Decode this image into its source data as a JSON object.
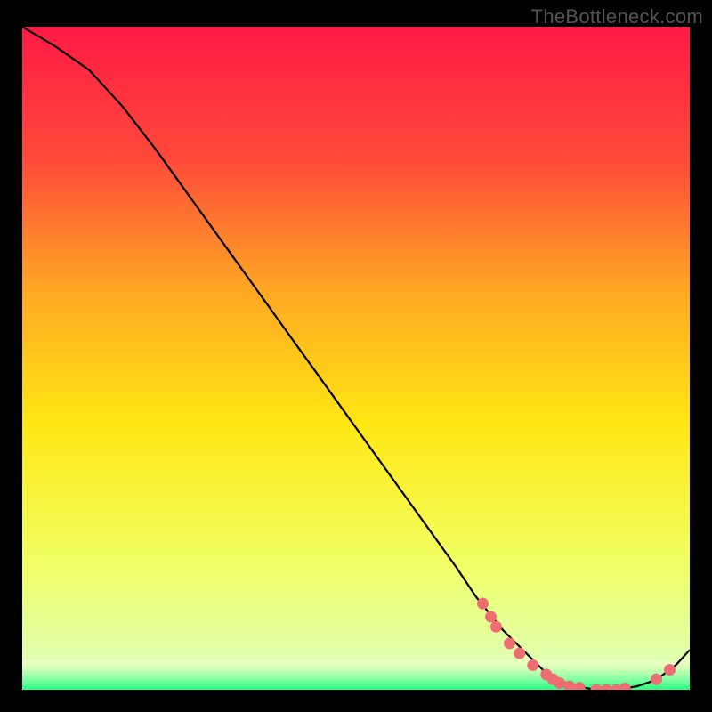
{
  "watermark": "TheBottleneck.com",
  "chart_data": {
    "type": "line",
    "title": "",
    "xlabel": "",
    "ylabel": "",
    "xlim": [
      0,
      100
    ],
    "ylim": [
      0,
      100
    ],
    "background_gradient": {
      "stops": [
        {
          "pos": 0.0,
          "color": "#ff1a45"
        },
        {
          "pos": 0.2,
          "color": "#ff4a3a"
        },
        {
          "pos": 0.4,
          "color": "#ffa822"
        },
        {
          "pos": 0.6,
          "color": "#ffe714"
        },
        {
          "pos": 0.8,
          "color": "#f2ff60"
        },
        {
          "pos": 0.965,
          "color": "#dfffb4"
        },
        {
          "pos": 0.985,
          "color": "#7dffa8"
        },
        {
          "pos": 1.0,
          "color": "#1efc7b"
        }
      ]
    },
    "series": [
      {
        "name": "curve",
        "color": "#000000",
        "x": [
          0,
          5,
          10,
          15,
          20,
          25,
          30,
          35,
          40,
          45,
          50,
          55,
          60,
          65,
          68,
          72,
          76,
          78,
          80,
          83,
          86,
          89,
          92,
          95,
          98,
          100
        ],
        "y": [
          100,
          97,
          93.5,
          88,
          81.5,
          74.5,
          67.5,
          60.5,
          53.5,
          46.5,
          39.5,
          32.5,
          25.5,
          18.5,
          14,
          9,
          5,
          3,
          1.5,
          0.5,
          0,
          0,
          0.5,
          1.5,
          3.8,
          6
        ]
      }
    ],
    "dot_series": {
      "name": "dots",
      "color": "#ee6d73",
      "points": [
        {
          "x": 69.0,
          "y": 13.0
        },
        {
          "x": 70.2,
          "y": 11.0
        },
        {
          "x": 71.0,
          "y": 9.5
        },
        {
          "x": 73.0,
          "y": 7.0
        },
        {
          "x": 74.5,
          "y": 5.5
        },
        {
          "x": 76.5,
          "y": 3.7
        },
        {
          "x": 78.5,
          "y": 2.3
        },
        {
          "x": 79.5,
          "y": 1.6
        },
        {
          "x": 80.5,
          "y": 1.0
        },
        {
          "x": 82.0,
          "y": 0.5
        },
        {
          "x": 83.5,
          "y": 0.3
        },
        {
          "x": 86.0,
          "y": 0.0
        },
        {
          "x": 87.5,
          "y": 0.0
        },
        {
          "x": 89.0,
          "y": 0.0
        },
        {
          "x": 90.3,
          "y": 0.2
        },
        {
          "x": 95.0,
          "y": 1.6
        },
        {
          "x": 97.0,
          "y": 3.0
        }
      ]
    }
  }
}
